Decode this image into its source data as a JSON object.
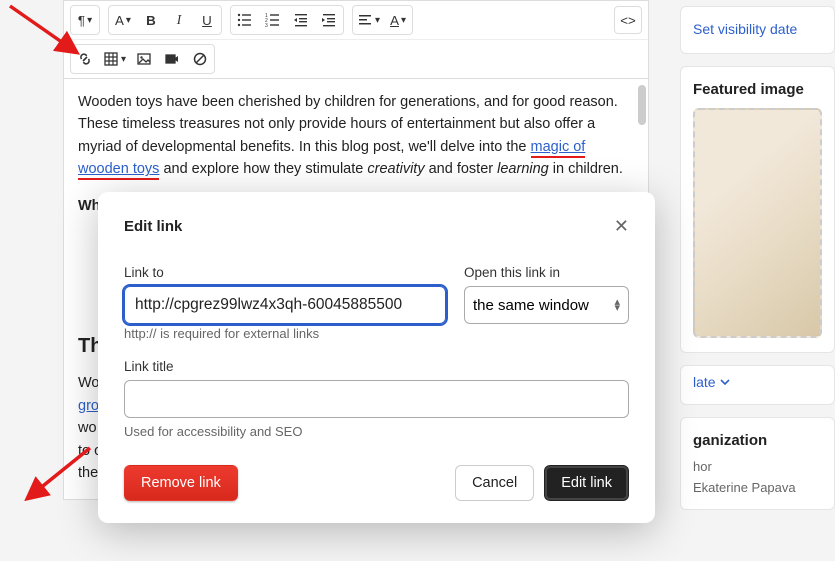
{
  "toolbar": {
    "paragraph_label": "¶",
    "font_label": "A",
    "bold_label": "B",
    "italic_label": "I",
    "underline_label": "U",
    "src_label": "<>"
  },
  "content": {
    "p1_a": "Wooden toys have been cherished by children for generations, and for good reason. These timeless treasures not only provide hours of entertainment but also offer a myriad of developmental benefits. In this blog post, we'll delve into the ",
    "link1": "magic of wooden toys",
    "p1_b": " and explore how they stimulate ",
    "em1": "creativity",
    "p1_c": " and foster ",
    "em2": "learning",
    "p1_d": " in children.",
    "sub1": "Wh",
    "h3_a": "Th",
    "p2_a": "Wo",
    "link2": "gro",
    "p2_b": "wo",
    "p2_c": "to o",
    "p2_d": "the"
  },
  "side": {
    "visibility": "Set visibility date",
    "featured_title": "Featured image",
    "late_label": "late",
    "org_title": "ganization",
    "author_label": "hor",
    "author_value": "Ekaterine Papava"
  },
  "modal": {
    "title": "Edit link",
    "link_to_label": "Link to",
    "url_value": "http://cpgrez99lwz4x3qh-60045885500",
    "url_hint": "http:// is required for external links",
    "open_in_label": "Open this link in",
    "open_in_value": "the same window",
    "title_label": "Link title",
    "title_value": "",
    "title_hint": "Used for accessibility and SEO",
    "remove_btn": "Remove link",
    "cancel_btn": "Cancel",
    "edit_btn": "Edit link"
  }
}
